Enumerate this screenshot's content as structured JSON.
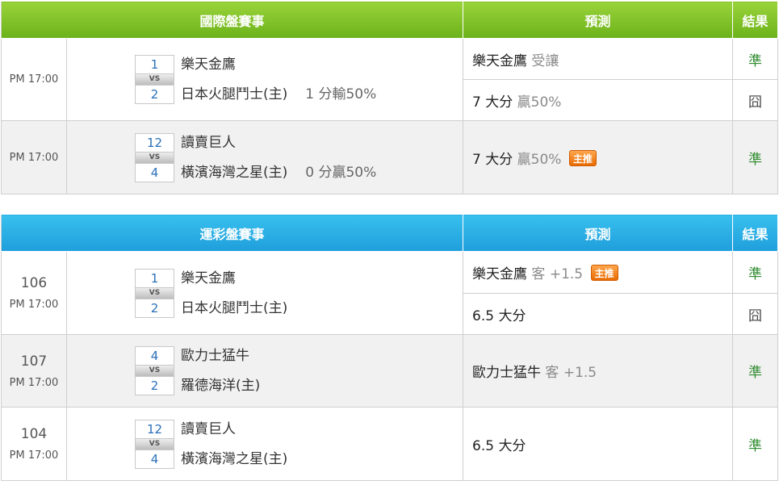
{
  "badge_label": "主推",
  "intl": {
    "header": {
      "title": "國際盤賽事",
      "prediction": "預測",
      "result": "結果"
    },
    "rows": [
      {
        "time": "PM 17:00",
        "home_score": "1",
        "away_score": "2",
        "vs": "VS",
        "home": "樂天金鷹",
        "away": "日本火腿鬥士(主)",
        "handicap": "1 分輸50%",
        "preds": [
          {
            "main": "樂天金鷹",
            "sub": "受讓",
            "badge": false,
            "result": "準"
          },
          {
            "main": "7 大分",
            "sub": "贏50%",
            "badge": false,
            "result": "囧"
          }
        ]
      },
      {
        "time": "PM 17:00",
        "home_score": "12",
        "away_score": "4",
        "vs": "VS",
        "home": "讀賣巨人",
        "away": "橫濱海灣之星(主)",
        "handicap": "0 分贏50%",
        "preds": [
          {
            "main": "7 大分",
            "sub": "贏50%",
            "badge": true,
            "result": "準"
          }
        ]
      }
    ]
  },
  "lottery": {
    "header": {
      "title": "運彩盤賽事",
      "prediction": "預測",
      "result": "結果"
    },
    "rows": [
      {
        "no": "106",
        "time": "PM 17:00",
        "home_score": "1",
        "away_score": "2",
        "vs": "VS",
        "home": "樂天金鷹",
        "away": "日本火腿鬥士(主)",
        "preds": [
          {
            "main": "樂天金鷹",
            "sub": "客 +1.5",
            "badge": true,
            "result": "準"
          },
          {
            "main": "6.5 大分",
            "sub": "",
            "badge": false,
            "result": "囧"
          }
        ]
      },
      {
        "no": "107",
        "time": "PM 17:00",
        "home_score": "4",
        "away_score": "2",
        "vs": "VS",
        "home": "歐力士猛牛",
        "away": "羅德海洋(主)",
        "preds": [
          {
            "main": "歐力士猛牛",
            "sub": "客 +1.5",
            "badge": false,
            "result": "準"
          }
        ]
      },
      {
        "no": "104",
        "time": "PM 17:00",
        "home_score": "12",
        "away_score": "4",
        "vs": "VS",
        "home": "讀賣巨人",
        "away": "橫濱海灣之星(主)",
        "preds": [
          {
            "main": "6.5 大分",
            "sub": "",
            "badge": false,
            "result": "準"
          }
        ]
      }
    ]
  }
}
